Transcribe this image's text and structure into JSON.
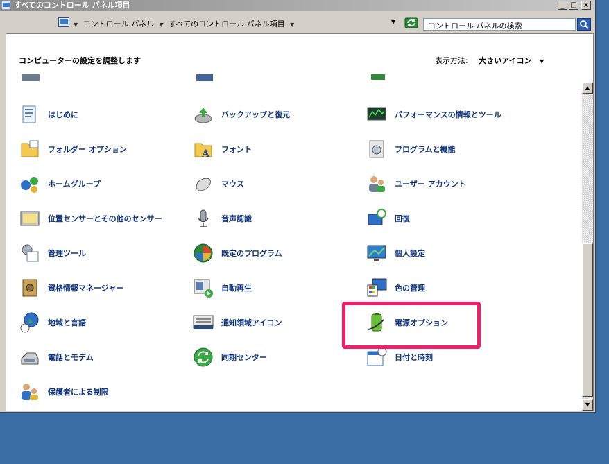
{
  "window": {
    "title": "すべてのコントロール パネル項目",
    "buttons": {
      "minimize": "_",
      "maximize": "□",
      "close": "×"
    }
  },
  "address": {
    "crumbs": [
      "コントロール パネル",
      "すべてのコントロール パネル項目"
    ],
    "search_placeholder": "コントロール パネルの検索"
  },
  "header": {
    "title": "コンピューターの設定を調整します",
    "view_by_label": "表示方法:",
    "view_by_value": "大きいアイコン"
  },
  "items": [
    {
      "label": "はじめに",
      "icon": "getting-started-icon"
    },
    {
      "label": "バックアップと復元",
      "icon": "backup-restore-icon"
    },
    {
      "label": "パフォーマンスの情報とツール",
      "icon": "performance-icon"
    },
    {
      "label": "フォルダー オプション",
      "icon": "folder-options-icon"
    },
    {
      "label": "フォント",
      "icon": "fonts-icon"
    },
    {
      "label": "プログラムと機能",
      "icon": "programs-features-icon"
    },
    {
      "label": "ホームグループ",
      "icon": "homegroup-icon"
    },
    {
      "label": "マウス",
      "icon": "mouse-icon"
    },
    {
      "label": "ユーザー アカウント",
      "icon": "user-accounts-icon"
    },
    {
      "label": "位置センサーとその他のセンサー",
      "icon": "location-sensors-icon"
    },
    {
      "label": "音声認識",
      "icon": "speech-recognition-icon"
    },
    {
      "label": "回復",
      "icon": "recovery-icon"
    },
    {
      "label": "管理ツール",
      "icon": "admin-tools-icon"
    },
    {
      "label": "既定のプログラム",
      "icon": "default-programs-icon"
    },
    {
      "label": "個人設定",
      "icon": "personalization-icon"
    },
    {
      "label": "資格情報マネージャー",
      "icon": "credential-manager-icon"
    },
    {
      "label": "自動再生",
      "icon": "autoplay-icon"
    },
    {
      "label": "色の管理",
      "icon": "color-management-icon"
    },
    {
      "label": "地域と言語",
      "icon": "region-language-icon"
    },
    {
      "label": "通知領域アイコン",
      "icon": "notification-area-icon"
    },
    {
      "label": "電源オプション",
      "icon": "power-options-icon"
    },
    {
      "label": "電話とモデム",
      "icon": "phone-modem-icon"
    },
    {
      "label": "同期センター",
      "icon": "sync-center-icon"
    },
    {
      "label": "日付と時刻",
      "icon": "date-time-icon"
    },
    {
      "label": "保護者による制限",
      "icon": "parental-controls-icon"
    }
  ],
  "colors": {
    "link": "#11357a",
    "highlight": "#f21e6a"
  }
}
